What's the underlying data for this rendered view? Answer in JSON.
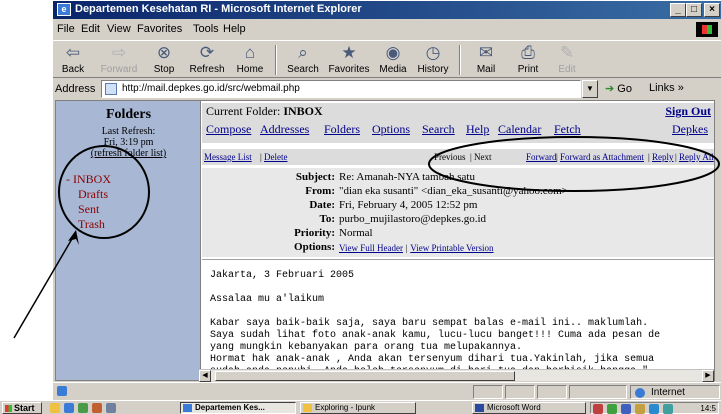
{
  "window": {
    "title": "Departemen Kesehatan RI - Microsoft Internet Explorer",
    "controls": [
      "_",
      "□",
      "×"
    ]
  },
  "menubar": {
    "items": [
      "File",
      "Edit",
      "View",
      "Favorites",
      "Tools",
      "Help"
    ]
  },
  "toolbar": {
    "items": [
      {
        "label": "Back",
        "icon": "back-arrow-icon"
      },
      {
        "label": "Forward",
        "icon": "forward-arrow-icon"
      },
      {
        "label": "Stop",
        "icon": "stop-icon"
      },
      {
        "label": "Refresh",
        "icon": "refresh-icon"
      },
      {
        "label": "Home",
        "icon": "home-icon"
      },
      {
        "label": "Search",
        "icon": "search-icon"
      },
      {
        "label": "Favorites",
        "icon": "favorites-icon"
      },
      {
        "label": "Media",
        "icon": "media-icon"
      },
      {
        "label": "History",
        "icon": "history-icon"
      },
      {
        "label": "Mail",
        "icon": "mail-icon"
      },
      {
        "label": "Print",
        "icon": "print-icon"
      },
      {
        "label": "Edit",
        "icon": "edit-icon"
      }
    ]
  },
  "addressbar": {
    "label": "Address",
    "url": "http://mail.depkes.go.id/src/webmail.php",
    "go_label": "Go",
    "links_label": "Links"
  },
  "sidebar": {
    "heading": "Folders",
    "last_refresh_label": "Last Refresh:",
    "last_refresh_time": "Fri, 3:19 pm",
    "refresh_link": "(refresh folder list)",
    "folders": [
      {
        "label": "INBOX",
        "prefix": "-"
      },
      {
        "label": "Drafts"
      },
      {
        "label": "Sent"
      },
      {
        "label": "Trash"
      }
    ]
  },
  "header": {
    "current_folder_label": "Current Folder:",
    "current_folder": "INBOX",
    "sign_out": "Sign Out",
    "nav": [
      "Compose",
      "Addresses",
      "Folders",
      "Options",
      "Search",
      "Help",
      "Calendar",
      "Fetch"
    ],
    "brand_link": "Depkes"
  },
  "message_bar": {
    "message_list": "Message List",
    "delete": "Delete",
    "previous": "Previous",
    "next": "Next",
    "forward": "Forward",
    "forward_attachment": "Forward as Attachment",
    "reply": "Reply",
    "reply_all": "Reply All"
  },
  "message_headers": {
    "subject_label": "Subject:",
    "subject": "Re: Amanah-NYA tambah satu",
    "from_label": "From:",
    "from": "\"dian eka susanti\" <dian_eka_susanti@yahoo.com>",
    "date_label": "Date:",
    "date": "Fri, February 4, 2005 12:52 pm",
    "to_label": "To:",
    "to": "purbo_mujilastoro@depkes.go.id",
    "priority_label": "Priority:",
    "priority": "Normal",
    "options_label": "Options:",
    "view_full_header": "View Full Header",
    "view_printable": "View Printable Version"
  },
  "message_body": {
    "lines": [
      "Jakarta, 3 Februari 2005",
      "Assalaa mu a'laikum",
      "Kabar saya baik-baik saja, saya baru sempat balas e-mail ini.. maklumlah.",
      "Saya sudah lihat foto anak-anak kamu, lucu-lucu banget!!! Cuma ada pesan de",
      "yang mungkin kebanyakan para orang tua melupakannya.",
      "Hormat hak anak-anak , Anda akan tersenyum dihari tua.Yakinlah, jika semua",
      "sudah anda penuhi. Anda boleh tersenyum di hari tua dan berbisik bangga \""
    ]
  },
  "statusbar": {
    "zone": "Internet"
  },
  "taskbar": {
    "start": "Start",
    "tasks": [
      {
        "label": "Departemen Kes...",
        "active": true
      },
      {
        "label": "Exploring - Ipunk",
        "active": false
      },
      {
        "label": "Microsoft Word",
        "active": false
      }
    ],
    "clock": "14:5"
  },
  "colors": {
    "titlebar": "#0a246a",
    "sidebar_bg": "#a8b8d4",
    "folder_text": "#8b0000",
    "link": "#00008b",
    "chrome": "#d4d0c8"
  }
}
